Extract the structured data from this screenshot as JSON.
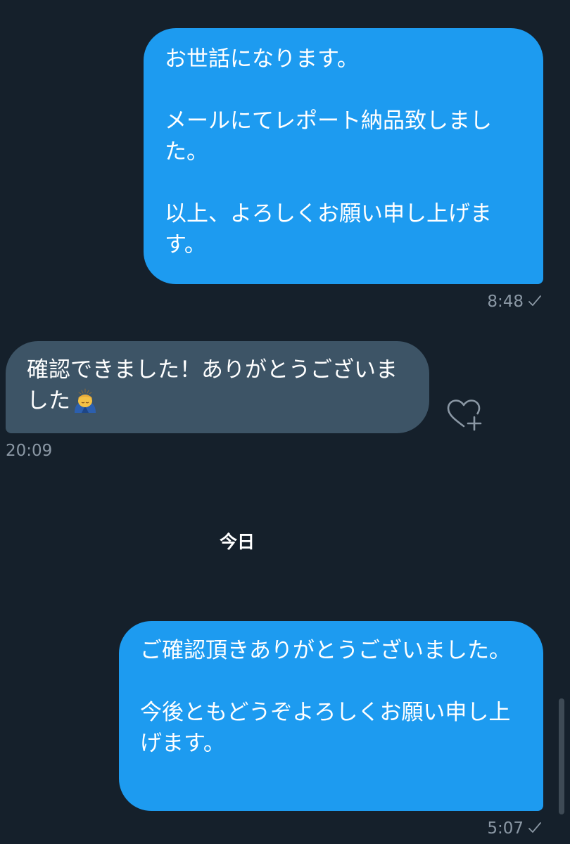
{
  "messages": [
    {
      "direction": "outgoing",
      "text": "お世話になります。\n\nメールにてレポート納品致しました。\n\n以上、よろしくお願い申し上げます。",
      "time": "8:48",
      "status_icon": "sent-check-icon"
    },
    {
      "direction": "incoming",
      "text": "確認できました！ありがとうございました",
      "emoji": "person-bowing-emoji",
      "time": "20:09",
      "reaction_icon": "add-reaction-heart-icon"
    },
    {
      "direction": "outgoing",
      "text": "ご確認頂きありがとうございました。\n\n今後ともどうぞよろしくお願い申し上げます。",
      "time": "5:07",
      "status_icon": "sent-check-icon"
    }
  ],
  "date_separator": "今日",
  "colors": {
    "background": "#15202b",
    "outgoing_bubble": "#1d9bf0",
    "incoming_bubble": "#3d5466",
    "meta_text": "#8b98a5",
    "text": "#ffffff"
  }
}
